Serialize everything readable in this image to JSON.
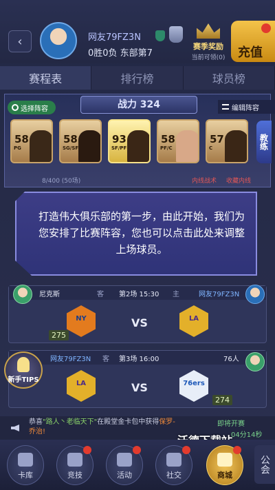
{
  "header": {
    "back_icon": "chevron-left-icon",
    "username": "网友79FZ3N",
    "record": "0胜0负 东部第7",
    "reward_title": "赛季奖励",
    "reward_sub": "当前可领(0)",
    "recharge": "充值"
  },
  "tabs": [
    {
      "label": "赛程表",
      "active": true
    },
    {
      "label": "排行榜",
      "active": false
    },
    {
      "label": "球员榜",
      "active": false
    }
  ],
  "lineup": {
    "select_label": "选择阵容",
    "power_label": "战力 324",
    "edit_label": "编辑阵容",
    "coach_label": "教练",
    "count": "8/400 (50场)",
    "tactics": "内线战术",
    "lost": "收藏内线",
    "cards": [
      {
        "rating": "58",
        "pos": "PG",
        "gold": false,
        "face": "#3a2818"
      },
      {
        "rating": "58",
        "pos": "SG/SF",
        "gold": false,
        "face": "#2a1a10"
      },
      {
        "rating": "93",
        "pos": "SF/PF",
        "gold": true,
        "face": "#3a2616"
      },
      {
        "rating": "58",
        "pos": "PF/C",
        "gold": false,
        "face": "#d8a888"
      },
      {
        "rating": "57",
        "pos": "C",
        "gold": false,
        "face": "#3a2616"
      }
    ]
  },
  "tip": {
    "text": "打造伟大俱乐部的第一步，由此开始，我们为您安排了比赛阵容，您也可以点击此处来调整上场球员。"
  },
  "matches": [
    {
      "home_name": "尼克斯",
      "home_tag": "客",
      "time": "第2场 15:30",
      "away_tag": "主",
      "away_name": "网友79FZ3N",
      "left_logo": "NY",
      "right_logo": "LA",
      "vs": "VS",
      "score": "275"
    },
    {
      "home_name": "网友79FZ3N",
      "home_tag": "客",
      "time": "第3场 16:00",
      "away_tag": "",
      "away_name": "76人",
      "left_logo": "LA",
      "right_logo": "76ers",
      "vs": "VS",
      "score": "274"
    }
  ],
  "tips_badge": "新手TIPS",
  "ticker": {
    "msg_prefix": "恭喜",
    "msg_hl": "\"路人丶老临天下\"",
    "msg_mid": "在殿堂金卡包中获得",
    "msg_hl2": "保罗-乔治!",
    "side1": "即将开赛",
    "side2": "04分14秒"
  },
  "watermark": "沃德下载站",
  "nav": [
    {
      "label": "卡库",
      "dot": false
    },
    {
      "label": "竞技",
      "dot": true
    },
    {
      "label": "活动",
      "dot": true
    },
    {
      "label": "社交",
      "dot": true
    },
    {
      "label": "商城",
      "dot": true
    }
  ],
  "guild": "公会",
  "colors": {
    "accent_gold": "#f4c34a",
    "accent_red": "#e23b2e",
    "accent_green": "#2a7e4a"
  }
}
